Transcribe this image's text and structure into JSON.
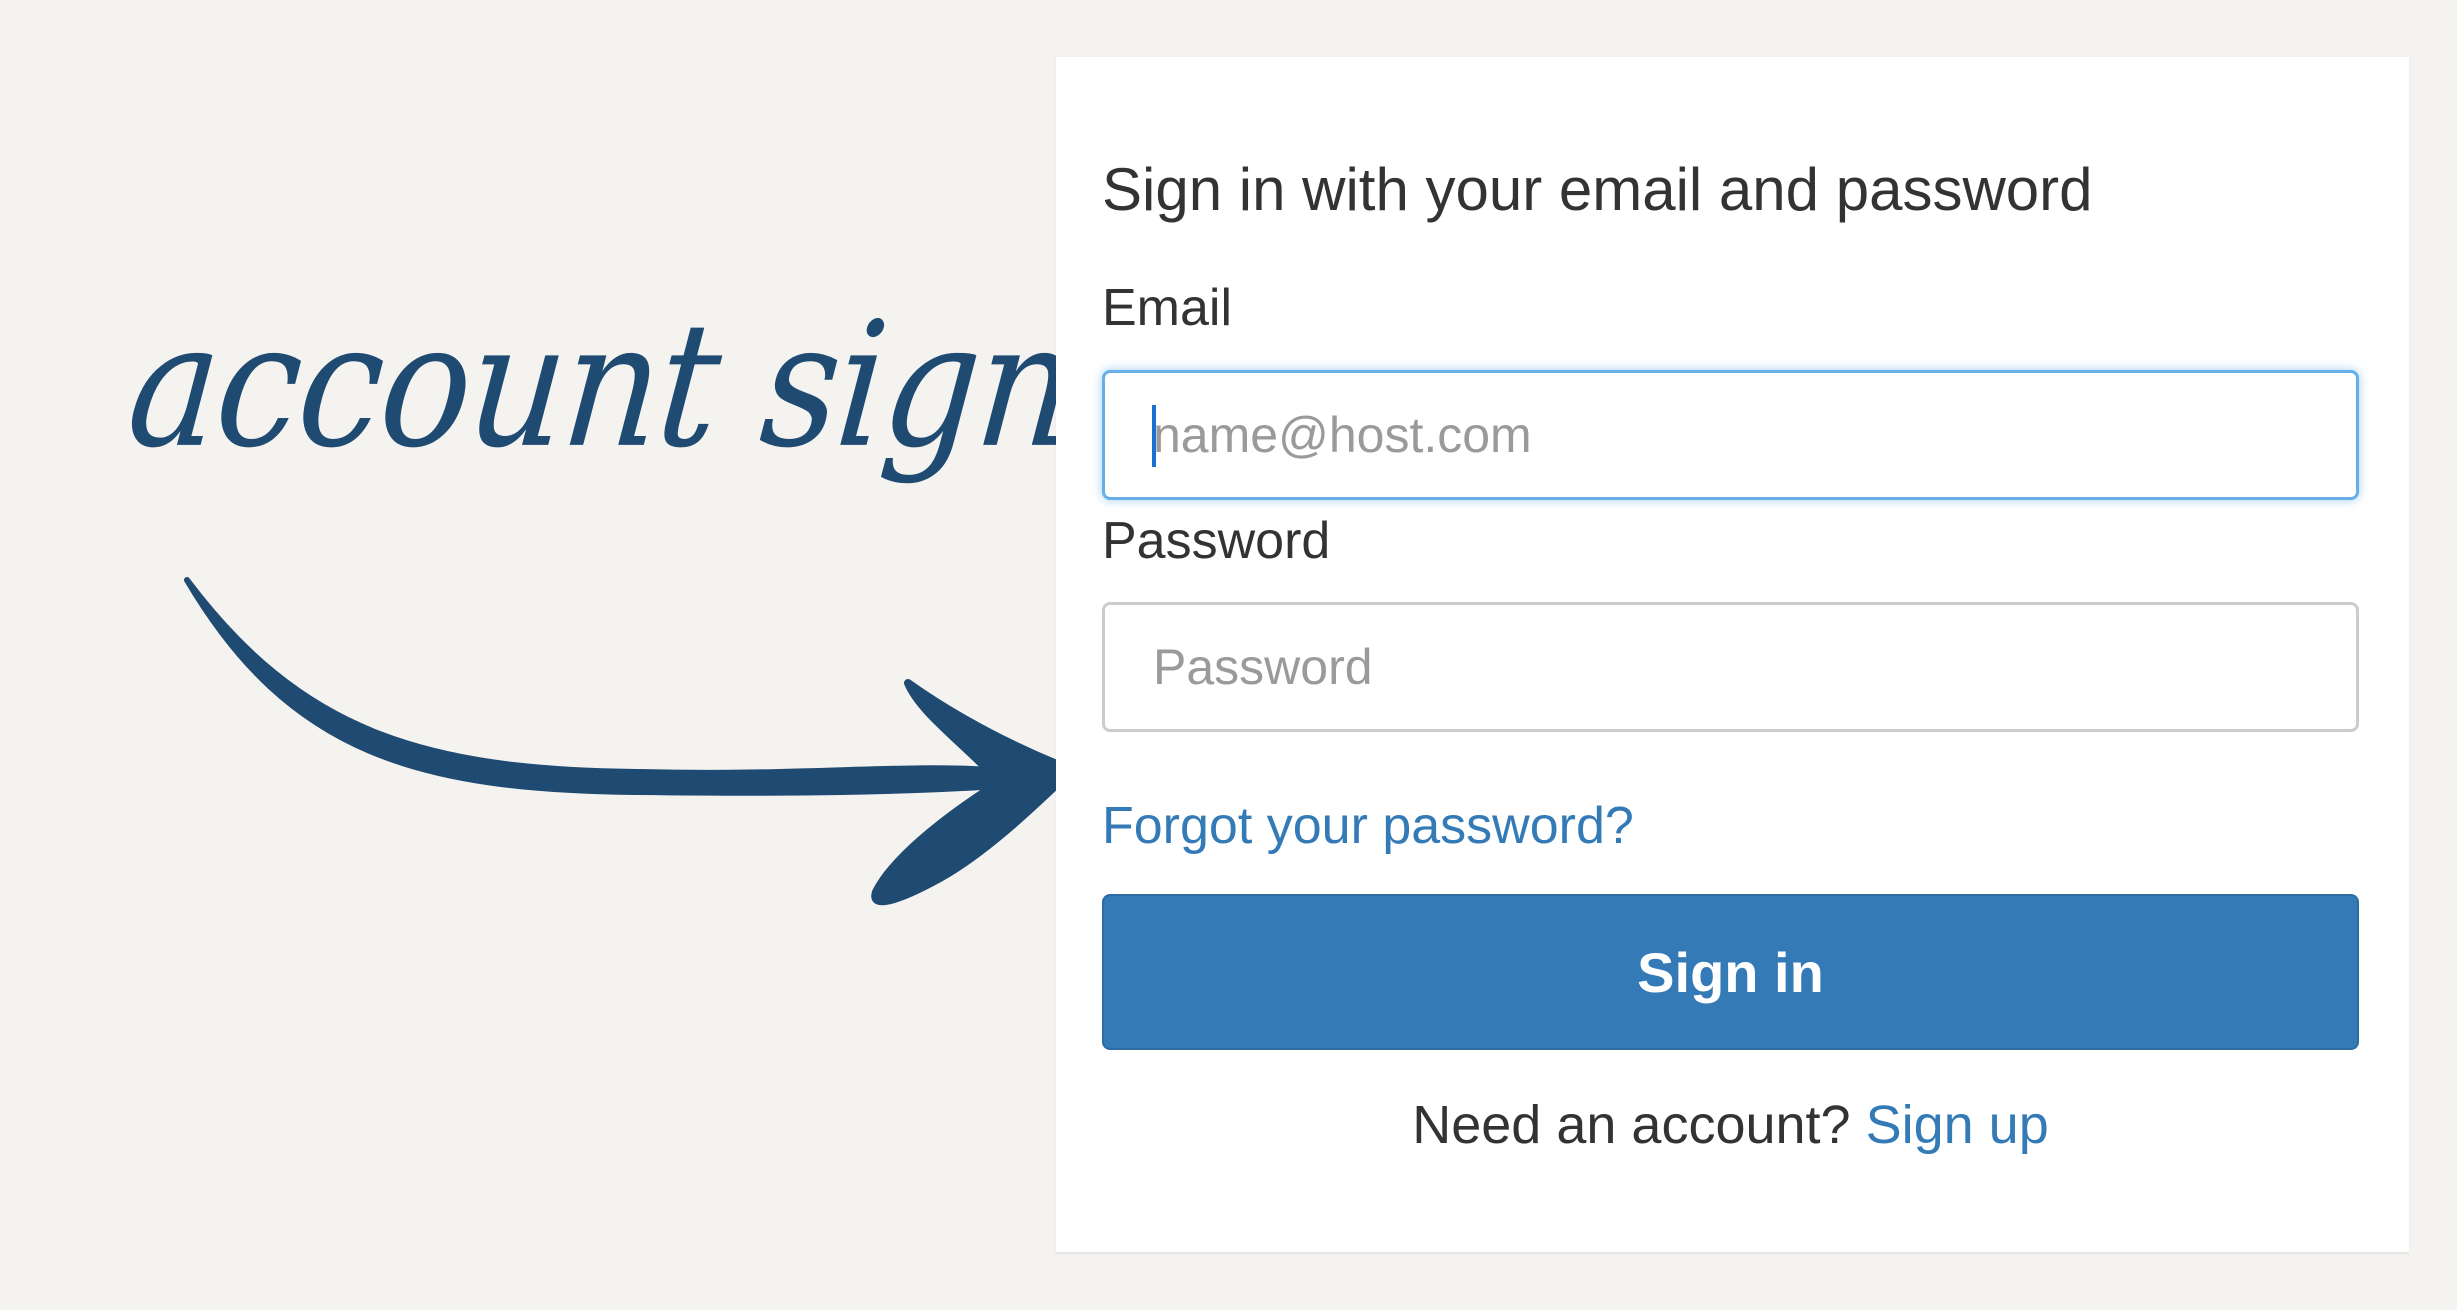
{
  "annotation": {
    "text": "account sign in",
    "color": "#1f4a72",
    "arrow_icon": "hand-drawn-arrow-right"
  },
  "form": {
    "title": "Sign in with your email and password",
    "email_label": "Email",
    "email_placeholder": "name@host.com",
    "email_value": "",
    "password_label": "Password",
    "password_placeholder": "Password",
    "password_value": "",
    "forgot_link": "Forgot your password?",
    "submit_label": "Sign in",
    "signup_prompt": "Need an account?",
    "signup_link": "Sign up"
  },
  "colors": {
    "page_background": "#f4f3f0",
    "card_background": "#ffffff",
    "primary": "#337ab7",
    "focus_ring": "#66afe9",
    "text": "#333333"
  }
}
